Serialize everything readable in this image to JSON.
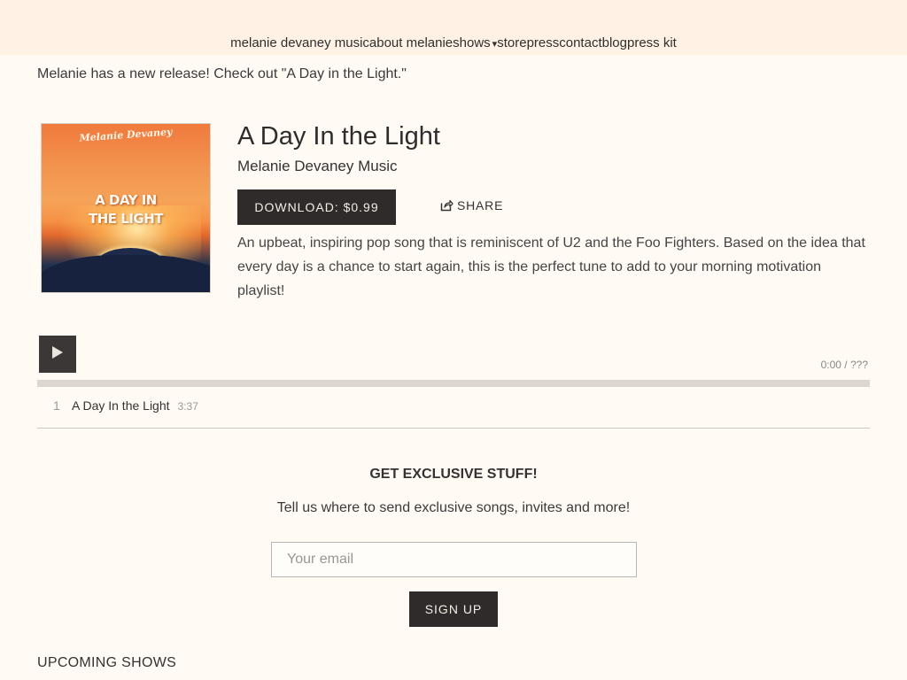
{
  "nav": {
    "items": [
      {
        "label": "melanie devaney music"
      },
      {
        "label": "about melanie"
      },
      {
        "label": "shows",
        "caret": "▾"
      },
      {
        "label": "store"
      },
      {
        "label": "press"
      },
      {
        "label": "contact"
      },
      {
        "label": "blog"
      },
      {
        "label": "press kit"
      }
    ]
  },
  "announcement": "Melanie has a new release!  Check out \"A Day in the Light.\"",
  "album": {
    "cover_artist": "Melanie Devaney",
    "cover_title_line1": "A DAY IN",
    "cover_title_line2": "THE LIGHT",
    "title": "A Day In the Light",
    "artist": "Melanie Devaney Music",
    "download_label": "DOWNLOAD: $0.99",
    "share_label": "SHARE",
    "description": "An upbeat, inspiring pop song that is reminiscent of U2 and the Foo Fighters. Based on the idea that every day is a chance to start again, this is the perfect tune to add to your morning motivation playlist!"
  },
  "player": {
    "current_time": "0:00",
    "separator": "/",
    "duration": "???",
    "progress": 0
  },
  "tracks": [
    {
      "number": "1",
      "name": "A Day In the Light",
      "length": "3:37"
    }
  ],
  "signup": {
    "heading": "GET EXCLUSIVE STUFF!",
    "subheading": "Tell us where to send exclusive songs, invites and more!",
    "email_placeholder": "Your email",
    "button_label": "SIGN UP"
  },
  "upcoming": {
    "heading": "UPCOMING SHOWS"
  },
  "colors": {
    "background": "#fffaf3",
    "header": "#fff1e3",
    "button": "#2f2b2a"
  },
  "icons": {
    "share": "share-icon",
    "play": "play-icon"
  }
}
